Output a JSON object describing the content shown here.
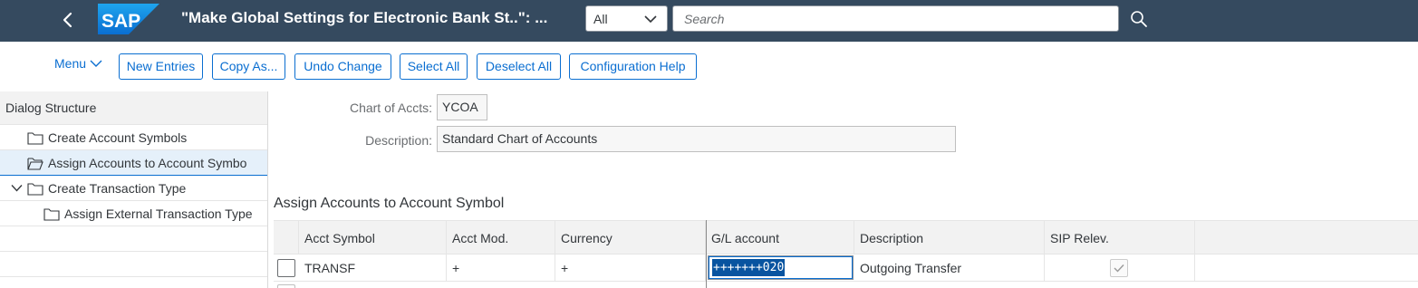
{
  "shell": {
    "title": "\"Make Global Settings for Electronic Bank St..\": ...",
    "logo_text": "SAP",
    "scope_value": "All",
    "search_placeholder": "Search",
    "header_bg": "#354a5f",
    "icons": [
      "back-icon",
      "chevron-down-icon",
      "search-icon"
    ]
  },
  "toolbar": {
    "menu_label": "Menu",
    "buttons": [
      "New Entries",
      "Copy As...",
      "Undo Change",
      "Select All",
      "Deselect All",
      "Configuration Help"
    ],
    "accent": "#0a6ed1"
  },
  "dialog": {
    "heading": "Dialog Structure",
    "items": [
      {
        "label": "Create Account Symbols",
        "icon": "folder-icon"
      },
      {
        "label": "Assign Accounts to Account Symbo",
        "icon": "folder-open-icon",
        "selected": true
      },
      {
        "label": "Create Transaction Type",
        "icon": "folder-icon",
        "expanded": true
      },
      {
        "label": "Assign External Transaction Type",
        "icon": "folder-icon"
      }
    ]
  },
  "header_fields": {
    "chart_label": "Chart of Accts:",
    "chart_value": "YCOA",
    "desc_label": "Description:",
    "desc_value": "Standard Chart of Accounts"
  },
  "section": {
    "title": "Assign Accounts to Account Symbol"
  },
  "table": {
    "columns": [
      "Acct Symbol",
      "Acct Mod.",
      "Currency",
      "G/L account",
      "Description",
      "SIP Relev."
    ],
    "rows": [
      {
        "acct_symbol": "TRANSF",
        "acct_mod": "+",
        "currency": "+",
        "gl_account": "+++++++020",
        "description": "Outgoing Transfer",
        "sip_relevant": true
      }
    ]
  }
}
